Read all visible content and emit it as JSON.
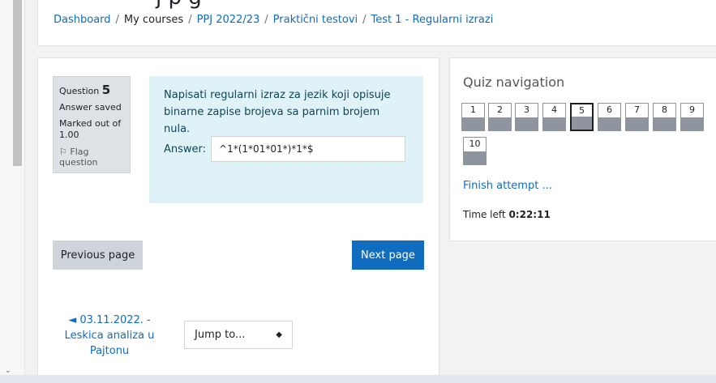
{
  "header": {
    "title_fragment": "j p g",
    "breadcrumb": [
      "Dashboard",
      "My courses",
      "PPJ 2022/23",
      "Praktični testovi",
      "Test 1 - Regularni izrazi"
    ]
  },
  "question": {
    "label": "Question",
    "number": "5",
    "status": "Answer saved",
    "marked_label": "Marked out of",
    "marked_value": "1.00",
    "flag_label": "Flag question",
    "text_line1": "Napisati regularni izraz za jezik koji opisuje",
    "text_line2": "binarne zapise brojeva sa parnim brojem nula.",
    "answer_label": "Answer:",
    "answer_value": "^1*(1*01*01*)*1*$"
  },
  "buttons": {
    "previous": "Previous page",
    "next": "Next page"
  },
  "prev_activity": {
    "line1": "◄ 03.11.2022. -",
    "line2": "Leskica analiza u",
    "line3": "Pajtonu"
  },
  "jump_to": {
    "selected": "Jump to..."
  },
  "quiz_nav": {
    "title": "Quiz navigation",
    "questions": [
      "1",
      "2",
      "3",
      "4",
      "5",
      "6",
      "7",
      "8",
      "9",
      "10"
    ],
    "current": "5",
    "finish_link": "Finish attempt ...",
    "time_label": "Time left",
    "time_value": "0:22:11"
  },
  "colors": {
    "link": "#0f6cbf",
    "primary_button": "#0f6cbf",
    "question_text_bg": "#def2f8",
    "info_box_bg": "#dee2e6"
  },
  "icons": {
    "flag": "flag-icon",
    "select_caret": "updown-caret-icon",
    "prev_arrow": "left-triangle-icon"
  }
}
